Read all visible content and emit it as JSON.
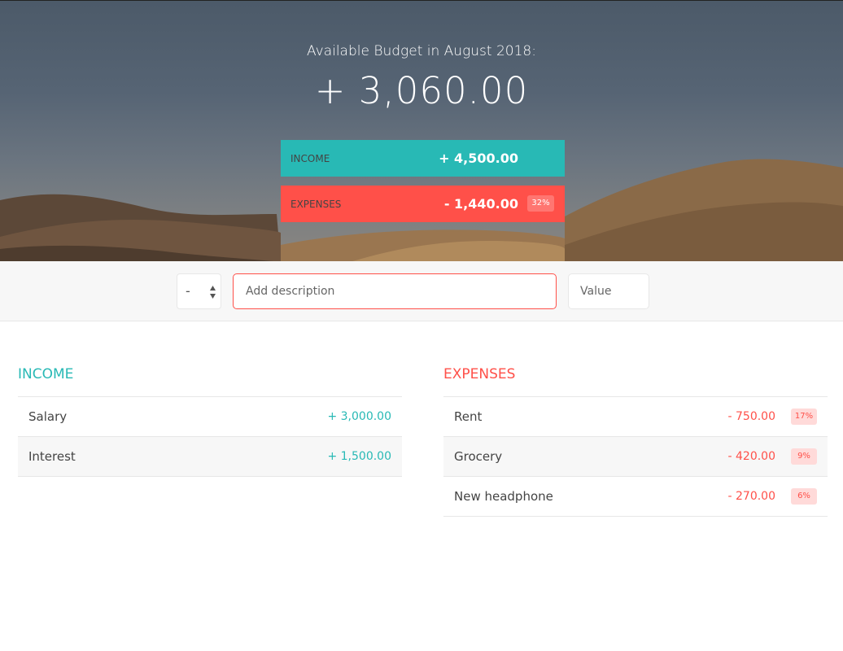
{
  "budget": {
    "title": "Available Budget in August 2018:",
    "value": "+ 3,060.00"
  },
  "summary": {
    "income": {
      "label": "Income",
      "value": "+ 4,500.00"
    },
    "expenses": {
      "label": "Expenses",
      "value": "- 1,440.00",
      "percentage": "32%"
    }
  },
  "add": {
    "type_value": "-",
    "description_placeholder": "Add description",
    "value_placeholder": "Value"
  },
  "income": {
    "title": "Income",
    "items": [
      {
        "description": "Salary",
        "value": "+ 3,000.00"
      },
      {
        "description": "Interest",
        "value": "+ 1,500.00"
      }
    ]
  },
  "expenses": {
    "title": "Expenses",
    "items": [
      {
        "description": "Rent",
        "value": "- 750.00",
        "percentage": "17%"
      },
      {
        "description": "Grocery",
        "value": "- 420.00",
        "percentage": "9%"
      },
      {
        "description": "New headphone",
        "value": "- 270.00",
        "percentage": "6%"
      }
    ]
  },
  "colors": {
    "income": "#28B9B5",
    "expenses": "#FF5049",
    "panel_bg": "#f7f7f7"
  },
  "icons": {
    "type_select": "up-down-arrows-icon"
  }
}
